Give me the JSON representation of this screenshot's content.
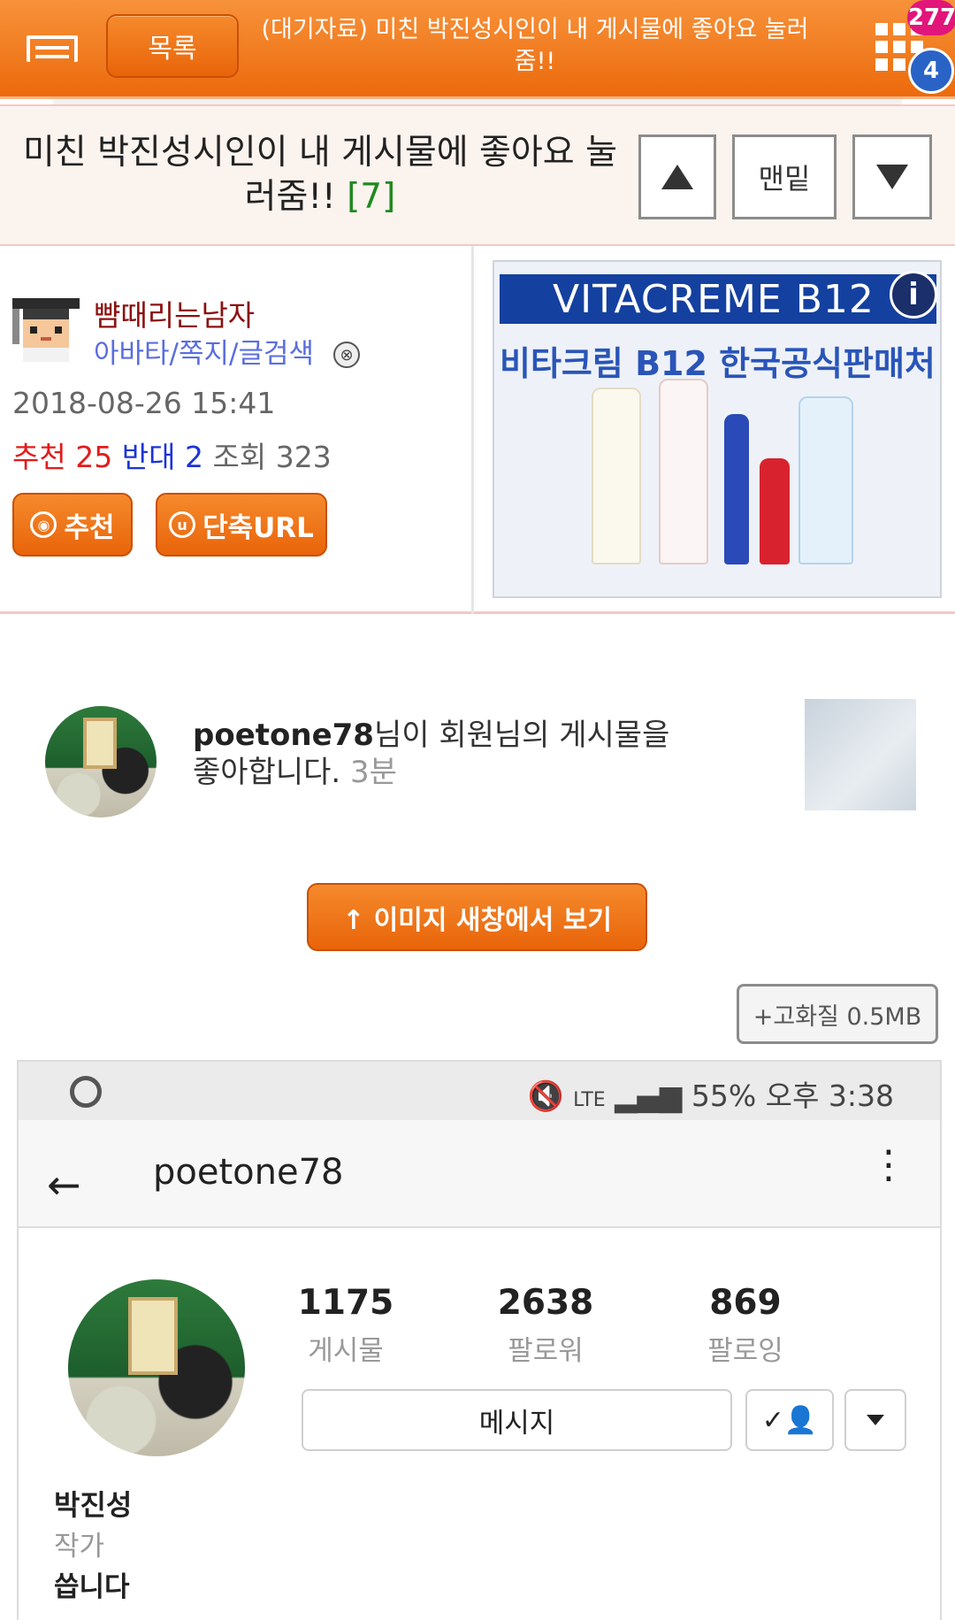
{
  "topbar": {
    "list_button": "목록",
    "title": "(대기자료) 미친 박진성시인이 내 게시물에 좋아요 눌러줌!!",
    "badge_notifications": "277",
    "badge_messages": "4"
  },
  "post": {
    "title": "미친 박진성시인이 내 게시물에 좋아요 눌러줌!!",
    "comment_count": "[7]",
    "nav": {
      "up_icon": "triangle-up",
      "bottom_label": "맨밑",
      "down_icon": "triangle-down"
    }
  },
  "author": {
    "nickname": "뺨때리는남자",
    "links": "아바타/쪽지/글검색",
    "date": "2018-08-26 15:41",
    "recommend_label": "추천",
    "recommend_count": "25",
    "oppose_label": "반대",
    "oppose_count": "2",
    "views_label": "조회",
    "views_count": "323",
    "recommend_button": "추천",
    "short_url_button": "단축URL"
  },
  "ad": {
    "brand": "VITACREME B12",
    "subtitle": "비타크림 B12 한국공식판매처",
    "info_icon": "i"
  },
  "notification": {
    "username": "poetone78",
    "message": "님이 회원님의 게시물을 좋아합니다.",
    "time": "3분"
  },
  "image_controls": {
    "view_new_window": "↑ 이미지 새창에서 보기",
    "high_quality": "+고화질 0.5MB"
  },
  "instagram": {
    "status_bar": "55% 오후 3:38",
    "network": "LTE",
    "username": "poetone78",
    "stats": [
      {
        "count": "1175",
        "label": "게시물"
      },
      {
        "count": "2638",
        "label": "팔로워"
      },
      {
        "count": "869",
        "label": "팔로잉"
      }
    ],
    "message_button": "메시지",
    "name": "박진성",
    "job": "작가",
    "bio": "씁니다"
  },
  "colors": {
    "accent_orange": "#ec6a0c",
    "recommend_red": "#e31b1b",
    "oppose_blue": "#1d34d6",
    "badge_pink": "#e2157a",
    "badge_blue": "#2a63c6"
  }
}
